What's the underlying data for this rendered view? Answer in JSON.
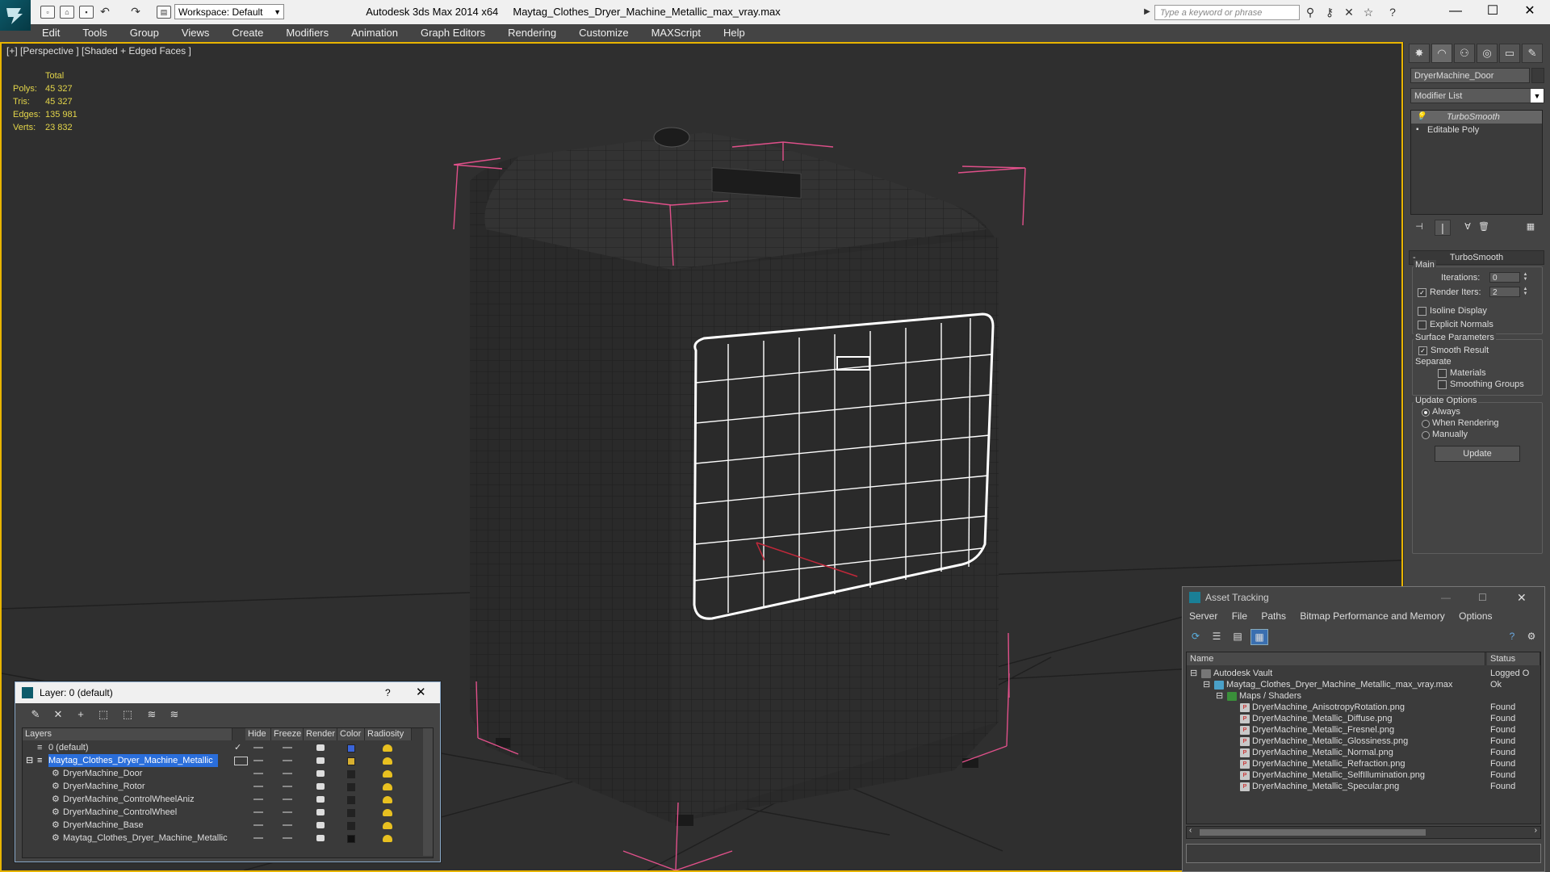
{
  "titlebar": {
    "workspace": "Workspace: Default",
    "app_title": "Autodesk 3ds Max  2014 x64",
    "file_title": "Maytag_Clothes_Dryer_Machine_Metallic_max_vray.max",
    "search_placeholder": "Type a keyword or phrase"
  },
  "menu": [
    "Edit",
    "Tools",
    "Group",
    "Views",
    "Create",
    "Modifiers",
    "Animation",
    "Graph Editors",
    "Rendering",
    "Customize",
    "MAXScript",
    "Help"
  ],
  "viewport": {
    "label": "[+] [Perspective ] [Shaded + Edged Faces ]",
    "stats": {
      "header": "Total",
      "rows": [
        {
          "label": "Polys:",
          "value": "45 327"
        },
        {
          "label": "Tris:",
          "value": "45 327"
        },
        {
          "label": "Edges:",
          "value": "135 981"
        },
        {
          "label": "Verts:",
          "value": "23 832"
        }
      ]
    },
    "accent_color": "#e8b400"
  },
  "command_panel": {
    "object_name": "DryerMachine_Door",
    "modifier_list": "Modifier List",
    "stack": [
      "TurboSmooth",
      "Editable Poly"
    ],
    "rollout_title": "TurboSmooth",
    "main_group": "Main",
    "iterations_label": "Iterations:",
    "iterations_value": "0",
    "render_iters_label": "Render Iters:",
    "render_iters_value": "2",
    "isoline_label": "Isoline Display",
    "explicit_normals_label": "Explicit Normals",
    "surface_group": "Surface Parameters",
    "smooth_result_label": "Smooth Result",
    "separate_label": "Separate",
    "materials_label": "Materials",
    "smoothing_groups_label": "Smoothing Groups",
    "update_group": "Update Options",
    "always_label": "Always",
    "when_rendering_label": "When Rendering",
    "manually_label": "Manually",
    "update_button": "Update"
  },
  "layer_dialog": {
    "title": "Layer: 0 (default)",
    "help": "?",
    "columns": [
      "Layers",
      "Hide",
      "Freeze",
      "Render",
      "Color",
      "Radiosity"
    ],
    "rows": [
      {
        "name": "0 (default)",
        "color": "#3a64d8",
        "selected": false,
        "indent": 1
      },
      {
        "name": "Maytag_Clothes_Dryer_Machine_Metallic",
        "color": "#d8b030",
        "selected": true,
        "indent": 1
      },
      {
        "name": "DryerMachine_Door",
        "color": "#222222",
        "selected": false,
        "indent": 2
      },
      {
        "name": "DryerMachine_Rotor",
        "color": "#222222",
        "selected": false,
        "indent": 2
      },
      {
        "name": "DryerMachine_ControlWheelAniz",
        "color": "#222222",
        "selected": false,
        "indent": 2
      },
      {
        "name": "DryerMachine_ControlWheel",
        "color": "#222222",
        "selected": false,
        "indent": 2
      },
      {
        "name": "DryerMachine_Base",
        "color": "#222222",
        "selected": false,
        "indent": 2
      },
      {
        "name": "Maytag_Clothes_Dryer_Machine_Metallic",
        "color": "#111111",
        "selected": false,
        "indent": 2
      }
    ]
  },
  "asset_dialog": {
    "title": "Asset Tracking",
    "menu": [
      "Server",
      "File",
      "Paths",
      "Bitmap Performance and Memory",
      "Options"
    ],
    "columns": [
      "Name",
      "Status"
    ],
    "rows": [
      {
        "name": "Autodesk Vault",
        "status": "Logged O",
        "indent": 0,
        "icon": "vault"
      },
      {
        "name": "Maytag_Clothes_Dryer_Machine_Metallic_max_vray.max",
        "status": "Ok",
        "indent": 1,
        "icon": "max"
      },
      {
        "name": "Maps / Shaders",
        "status": "",
        "indent": 2,
        "icon": "folder"
      },
      {
        "name": "DryerMachine_AnisotropyRotation.png",
        "status": "Found",
        "indent": 3,
        "icon": "png"
      },
      {
        "name": "DryerMachine_Metallic_Diffuse.png",
        "status": "Found",
        "indent": 3,
        "icon": "png"
      },
      {
        "name": "DryerMachine_Metallic_Fresnel.png",
        "status": "Found",
        "indent": 3,
        "icon": "png"
      },
      {
        "name": "DryerMachine_Metallic_Glossiness.png",
        "status": "Found",
        "indent": 3,
        "icon": "png"
      },
      {
        "name": "DryerMachine_Metallic_Normal.png",
        "status": "Found",
        "indent": 3,
        "icon": "png"
      },
      {
        "name": "DryerMachine_Metallic_Refraction.png",
        "status": "Found",
        "indent": 3,
        "icon": "png"
      },
      {
        "name": "DryerMachine_Metallic_SelfIllumination.png",
        "status": "Found",
        "indent": 3,
        "icon": "png"
      },
      {
        "name": "DryerMachine_Metallic_Specular.png",
        "status": "Found",
        "indent": 3,
        "icon": "png"
      }
    ]
  }
}
